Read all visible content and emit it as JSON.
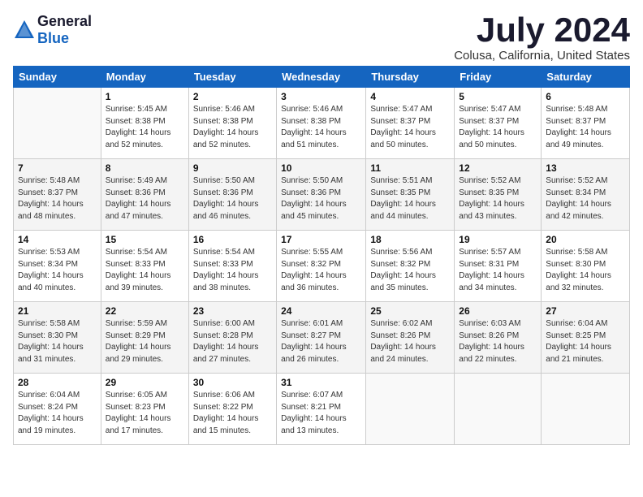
{
  "logo": {
    "general": "General",
    "blue": "Blue"
  },
  "title": "July 2024",
  "location": "Colusa, California, United States",
  "weekdays": [
    "Sunday",
    "Monday",
    "Tuesday",
    "Wednesday",
    "Thursday",
    "Friday",
    "Saturday"
  ],
  "weeks": [
    [
      {
        "day": "",
        "info": ""
      },
      {
        "day": "1",
        "info": "Sunrise: 5:45 AM\nSunset: 8:38 PM\nDaylight: 14 hours\nand 52 minutes."
      },
      {
        "day": "2",
        "info": "Sunrise: 5:46 AM\nSunset: 8:38 PM\nDaylight: 14 hours\nand 52 minutes."
      },
      {
        "day": "3",
        "info": "Sunrise: 5:46 AM\nSunset: 8:38 PM\nDaylight: 14 hours\nand 51 minutes."
      },
      {
        "day": "4",
        "info": "Sunrise: 5:47 AM\nSunset: 8:37 PM\nDaylight: 14 hours\nand 50 minutes."
      },
      {
        "day": "5",
        "info": "Sunrise: 5:47 AM\nSunset: 8:37 PM\nDaylight: 14 hours\nand 50 minutes."
      },
      {
        "day": "6",
        "info": "Sunrise: 5:48 AM\nSunset: 8:37 PM\nDaylight: 14 hours\nand 49 minutes."
      }
    ],
    [
      {
        "day": "7",
        "info": "Sunrise: 5:48 AM\nSunset: 8:37 PM\nDaylight: 14 hours\nand 48 minutes."
      },
      {
        "day": "8",
        "info": "Sunrise: 5:49 AM\nSunset: 8:36 PM\nDaylight: 14 hours\nand 47 minutes."
      },
      {
        "day": "9",
        "info": "Sunrise: 5:50 AM\nSunset: 8:36 PM\nDaylight: 14 hours\nand 46 minutes."
      },
      {
        "day": "10",
        "info": "Sunrise: 5:50 AM\nSunset: 8:36 PM\nDaylight: 14 hours\nand 45 minutes."
      },
      {
        "day": "11",
        "info": "Sunrise: 5:51 AM\nSunset: 8:35 PM\nDaylight: 14 hours\nand 44 minutes."
      },
      {
        "day": "12",
        "info": "Sunrise: 5:52 AM\nSunset: 8:35 PM\nDaylight: 14 hours\nand 43 minutes."
      },
      {
        "day": "13",
        "info": "Sunrise: 5:52 AM\nSunset: 8:34 PM\nDaylight: 14 hours\nand 42 minutes."
      }
    ],
    [
      {
        "day": "14",
        "info": "Sunrise: 5:53 AM\nSunset: 8:34 PM\nDaylight: 14 hours\nand 40 minutes."
      },
      {
        "day": "15",
        "info": "Sunrise: 5:54 AM\nSunset: 8:33 PM\nDaylight: 14 hours\nand 39 minutes."
      },
      {
        "day": "16",
        "info": "Sunrise: 5:54 AM\nSunset: 8:33 PM\nDaylight: 14 hours\nand 38 minutes."
      },
      {
        "day": "17",
        "info": "Sunrise: 5:55 AM\nSunset: 8:32 PM\nDaylight: 14 hours\nand 36 minutes."
      },
      {
        "day": "18",
        "info": "Sunrise: 5:56 AM\nSunset: 8:32 PM\nDaylight: 14 hours\nand 35 minutes."
      },
      {
        "day": "19",
        "info": "Sunrise: 5:57 AM\nSunset: 8:31 PM\nDaylight: 14 hours\nand 34 minutes."
      },
      {
        "day": "20",
        "info": "Sunrise: 5:58 AM\nSunset: 8:30 PM\nDaylight: 14 hours\nand 32 minutes."
      }
    ],
    [
      {
        "day": "21",
        "info": "Sunrise: 5:58 AM\nSunset: 8:30 PM\nDaylight: 14 hours\nand 31 minutes."
      },
      {
        "day": "22",
        "info": "Sunrise: 5:59 AM\nSunset: 8:29 PM\nDaylight: 14 hours\nand 29 minutes."
      },
      {
        "day": "23",
        "info": "Sunrise: 6:00 AM\nSunset: 8:28 PM\nDaylight: 14 hours\nand 27 minutes."
      },
      {
        "day": "24",
        "info": "Sunrise: 6:01 AM\nSunset: 8:27 PM\nDaylight: 14 hours\nand 26 minutes."
      },
      {
        "day": "25",
        "info": "Sunrise: 6:02 AM\nSunset: 8:26 PM\nDaylight: 14 hours\nand 24 minutes."
      },
      {
        "day": "26",
        "info": "Sunrise: 6:03 AM\nSunset: 8:26 PM\nDaylight: 14 hours\nand 22 minutes."
      },
      {
        "day": "27",
        "info": "Sunrise: 6:04 AM\nSunset: 8:25 PM\nDaylight: 14 hours\nand 21 minutes."
      }
    ],
    [
      {
        "day": "28",
        "info": "Sunrise: 6:04 AM\nSunset: 8:24 PM\nDaylight: 14 hours\nand 19 minutes."
      },
      {
        "day": "29",
        "info": "Sunrise: 6:05 AM\nSunset: 8:23 PM\nDaylight: 14 hours\nand 17 minutes."
      },
      {
        "day": "30",
        "info": "Sunrise: 6:06 AM\nSunset: 8:22 PM\nDaylight: 14 hours\nand 15 minutes."
      },
      {
        "day": "31",
        "info": "Sunrise: 6:07 AM\nSunset: 8:21 PM\nDaylight: 14 hours\nand 13 minutes."
      },
      {
        "day": "",
        "info": ""
      },
      {
        "day": "",
        "info": ""
      },
      {
        "day": "",
        "info": ""
      }
    ]
  ]
}
